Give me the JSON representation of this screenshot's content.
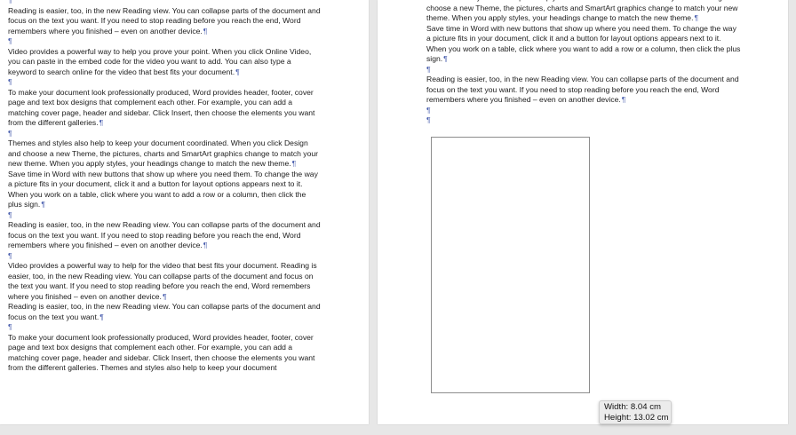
{
  "left_page": {
    "blocks": [
      {
        "type": "empty"
      },
      {
        "type": "para",
        "text": "Reading is easier, too, in the new Reading view. You can collapse parts of the document and focus on the text you want. If you need to stop reading before you reach the end, Word remembers where you finished – even on another device."
      },
      {
        "type": "empty"
      },
      {
        "type": "para",
        "text": "Video provides a powerful way to help you prove your point. When you click Online Video, you can paste in the embed code for the video you want to add. You can also type a keyword to search online for the video that best fits your document."
      },
      {
        "type": "empty"
      },
      {
        "type": "para",
        "text": "To make your document look professionally produced, Word provides header, footer, cover page and text box designs that complement each other. For example, you can add a matching cover page, header and sidebar. Click Insert, then choose the elements you want from the different galleries."
      },
      {
        "type": "empty"
      },
      {
        "type": "para",
        "text": "Themes and styles also help to keep your document coordinated. When you click Design and choose a new Theme, the pictures, charts and SmartArt graphics change to match your new theme. When you apply styles, your headings change to match the new theme."
      },
      {
        "type": "para",
        "text": "Save time in Word with new buttons that show up where you need them. To change the way a picture fits in your document, click it and a button for layout options appears next to it. When you work on a table, click where you want to add a row or a column, then click the plus sign."
      },
      {
        "type": "empty"
      },
      {
        "type": "para",
        "text": "Reading is easier, too, in the new Reading view. You can collapse parts of the document and focus on the text you want. If you need to stop reading before you reach the end, Word remembers where you finished – even on another device."
      },
      {
        "type": "empty"
      },
      {
        "type": "para",
        "text": "Video provides a powerful way to help for the video that best fits your document. Reading is easier, too, in the new Reading view. You can collapse parts of the document and focus on the text you want. If you need to stop reading before you reach the end, Word remembers where you finished – even on another device."
      },
      {
        "type": "para",
        "text": "Reading is easier, too, in the new Reading view. You can collapse parts of the document and focus on the text you want."
      },
      {
        "type": "empty"
      },
      {
        "type": "para",
        "text": "To make your document look professionally produced, Word provides header, footer, cover page and text box designs that complement each other. For example, you can add a matching cover page, header and sidebar. Click Insert, then choose the elements you want from the different galleries. Themes and styles also help to keep your document",
        "no_mark": true
      }
    ]
  },
  "right_page": {
    "blocks": [
      {
        "type": "para",
        "text": "Themes and styles also help to keep your document coordinated. When you click Design and choose a new Theme, the pictures, charts and SmartArt graphics change to match your new theme. When you apply styles, your headings change to match the new theme."
      },
      {
        "type": "para",
        "text": "Save time in Word with new buttons that show up where you need them. To change the way a picture fits in your document, click it and a button for layout options appears next to it. When you work on a table, click where you want to add a row or a column, then click the plus sign."
      },
      {
        "type": "empty"
      },
      {
        "type": "para",
        "text": "Reading is easier, too, in the new Reading view. You can collapse parts of the document and focus on the text you want. If you need to stop reading before you reach the end, Word remembers where you finished – even on another device."
      },
      {
        "type": "empty"
      },
      {
        "type": "empty"
      }
    ]
  },
  "pilcrow": "¶",
  "size_tooltip": {
    "width_text": "Width: 8.04 cm",
    "height_text": "Height: 13.02 cm"
  }
}
